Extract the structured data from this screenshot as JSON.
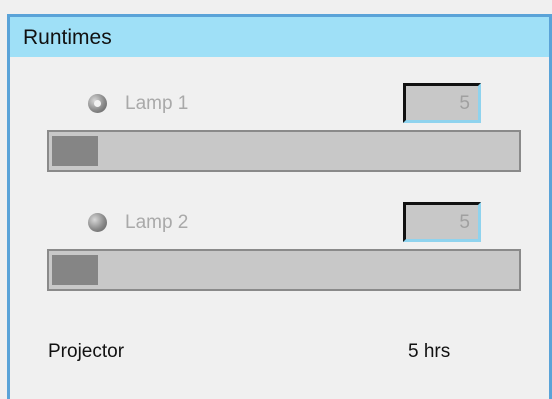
{
  "panel": {
    "title": "Runtimes"
  },
  "lamps": [
    {
      "label": "Lamp 1",
      "selected": true,
      "value": "5",
      "progress_fraction": 0.1
    },
    {
      "label": "Lamp 2",
      "selected": false,
      "value": "5",
      "progress_fraction": 0.1
    }
  ],
  "projector": {
    "label": "Projector",
    "value": "5 hrs"
  },
  "colors": {
    "title_bar": "#9fe0f7",
    "border_accent": "#5aa3d8",
    "disabled_text": "#a9a9a9",
    "bar_fill": "#858585",
    "bar_track": "#c8c8c8"
  }
}
